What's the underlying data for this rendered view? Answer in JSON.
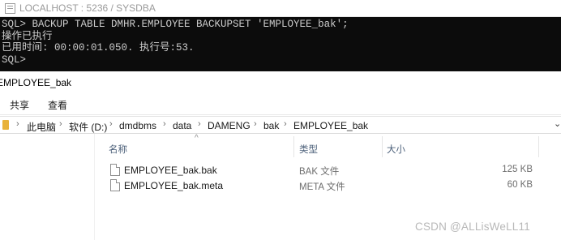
{
  "terminal_window": {
    "title": "LOCALHOST : 5236 / SYSDBA",
    "lines": [
      "SQL> BACKUP TABLE DMHR.EMPLOYEE BACKUPSET 'EMPLOYEE_bak';",
      "操作已执行",
      "已用时间: 00:00:01.050. 执行号:53.",
      "SQL>"
    ]
  },
  "explorer": {
    "window_title": "EMPLOYEE_bak",
    "ribbon_tabs": [
      "共享",
      "查看"
    ],
    "breadcrumb": [
      "此电脑",
      "软件 (D:)",
      "dmdbms",
      "data",
      "DAMENG",
      "bak",
      "EMPLOYEE_bak"
    ],
    "columns": {
      "name": "名称",
      "type": "类型",
      "size": "大小"
    },
    "files": [
      {
        "name": "EMPLOYEE_bak.bak",
        "type": "BAK 文件",
        "size": "125 KB",
        "icon": "file-icon"
      },
      {
        "name": "EMPLOYEE_bak.meta",
        "type": "META 文件",
        "size": "60 KB",
        "icon": "file-icon"
      }
    ]
  },
  "watermark": "CSDN @ALLisWeLL11",
  "colors": {
    "terminal_bg": "#0c0c0c",
    "terminal_text": "#cccccc",
    "folder": "#e8b23a",
    "column_header": "#4c607a"
  }
}
